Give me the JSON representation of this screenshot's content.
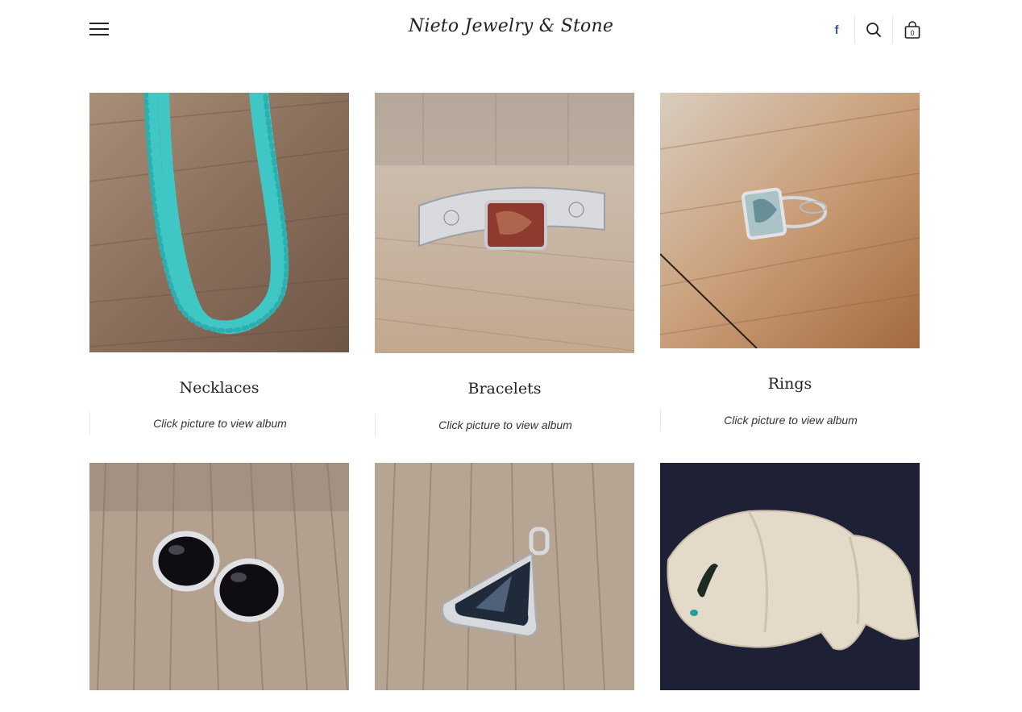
{
  "header": {
    "site_title": "Nieto Jewelry & Stone",
    "icons": {
      "menu": "hamburger-menu-icon",
      "social": "facebook-icon",
      "search": "search-icon",
      "cart": "shopping-bag-icon"
    },
    "facebook_glyph": "f",
    "cart_count": "0"
  },
  "albums": [
    {
      "title": "Necklaces",
      "caption": "Click picture to view album",
      "image": "turquoise-chip-necklace-photo"
    },
    {
      "title": "Bracelets",
      "caption": "Click picture to view album",
      "image": "silver-cuff-bracelet-photo"
    },
    {
      "title": "Rings",
      "caption": "Click picture to view album",
      "image": "abalone-silver-ring-photo"
    },
    {
      "title": "",
      "caption": "",
      "image": "onyx-silver-earrings-photo"
    },
    {
      "title": "",
      "caption": "",
      "image": "pietersite-silver-pendant-photo"
    },
    {
      "title": "",
      "caption": "",
      "image": "stone-buffalo-carving-photo"
    }
  ],
  "colors": {
    "facebook": "#3b5998",
    "text": "#222222",
    "wood": "#b89a7f",
    "turquoise": "#3cc4c4"
  }
}
